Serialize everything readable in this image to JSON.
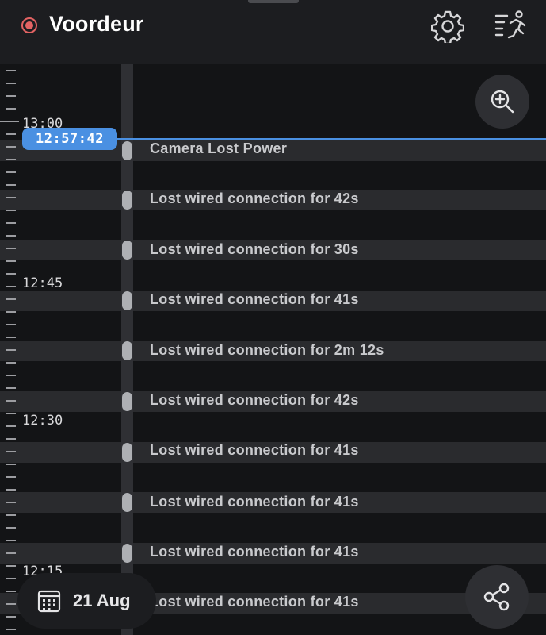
{
  "header": {
    "title": "Voordeur",
    "status_color": "#e36363",
    "settings_icon": "gear-icon",
    "activity_icon": "running-person-icon"
  },
  "timeline": {
    "current_time": "12:57:42",
    "accent_color": "#4a90e2",
    "time_labels": [
      "13:00",
      "12:45",
      "12:30",
      "12:15"
    ],
    "events": [
      {
        "label": "Camera Lost Power"
      },
      {
        "label": "Lost wired connection for 42s"
      },
      {
        "label": "Lost wired connection for 30s"
      },
      {
        "label": "Lost wired connection for 41s"
      },
      {
        "label": "Lost wired connection for 2m 12s"
      },
      {
        "label": "Lost wired connection for 42s"
      },
      {
        "label": "Lost wired connection for 41s"
      },
      {
        "label": "Lost wired connection for 41s"
      },
      {
        "label": "Lost wired connection for 41s"
      },
      {
        "label": "Lost wired connection for 41s"
      }
    ]
  },
  "controls": {
    "date_label": "21 Aug",
    "zoom_icon": "zoom-in-icon",
    "share_icon": "share-icon",
    "calendar_icon": "calendar-icon"
  }
}
